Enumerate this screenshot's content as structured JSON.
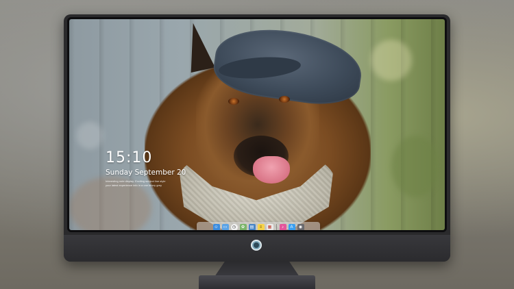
{
  "lock_screen": {
    "time": "15:10",
    "date": "Sunday September 20",
    "subtitle_lines": [
      "Interesting note display. Exciting subject line style",
      "your latest experience info in a one blurry grey"
    ]
  },
  "dock": {
    "apps": [
      {
        "name": "finder",
        "icon": "finder-icon",
        "color": "#3b8de0"
      },
      {
        "name": "folder",
        "icon": "folder-icon",
        "color": "#5aa3e6"
      },
      {
        "name": "clock",
        "icon": "clock-icon",
        "color": "#f2f2f2"
      },
      {
        "name": "photos",
        "icon": "photos-icon",
        "color": "#7bb56a"
      },
      {
        "name": "movie",
        "icon": "clapperboard-icon",
        "color": "#4a86c7"
      },
      {
        "name": "notes",
        "icon": "notes-icon",
        "color": "#f6d34c"
      },
      {
        "name": "calendar",
        "icon": "calendar-icon",
        "color": "#e9e9e9"
      },
      {
        "name": "music",
        "icon": "music-icon",
        "color": "#e3569b"
      },
      {
        "name": "app-store",
        "icon": "app-store-icon",
        "color": "#3a9ff0"
      },
      {
        "name": "camera",
        "icon": "camera-icon",
        "color": "#6a6a6e"
      }
    ]
  }
}
